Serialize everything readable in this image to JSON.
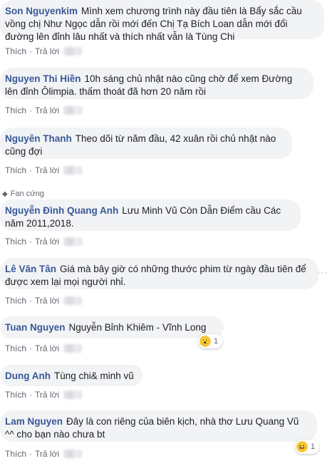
{
  "actions": {
    "like": "Thích",
    "reply": "Trả lời",
    "separator": "·"
  },
  "fan_badge": "Fan cứng",
  "comments": [
    {
      "name": "Son Nguyenkim",
      "text": "Mình xem chương trình này đầu tiên là Bẩy sắc cầu vồng chị Như Ngọc dẫn rồi mới đến Chị Tạ Bích Loan dẫn mới đổi đường lên đỉnh lâu nhất và thích nhất vẫn là Tùng Chi"
    },
    {
      "name": "Nguyen Thi Hiền",
      "text": "10h sáng chủ nhật nào cũng chờ để xem Đường lên đỉnh Ôlimpia. thấm thoát đã hơn 20 năm rồi"
    },
    {
      "name": "Nguyên Thanh",
      "text": "Theo dõi từ năm đầu, 42 xuân rồi chủ nhật nào cũng đợi"
    },
    {
      "name": "Nguyễn Đình Quang Anh",
      "text": "Lưu Minh Vũ Còn Dẫn Điểm cầu Các năm 2011,2018."
    },
    {
      "name": "Lê Văn Tân",
      "text": "Giá mà bây giờ có những thước phim từ ngày đầu tiên để được xem lại mọi người nhỉ."
    },
    {
      "name": "Tuan Nguyen",
      "text": "Nguyễn Bỉnh Khiêm - Vĩnh Long",
      "reaction_count": "1"
    },
    {
      "name": "Dung Anh",
      "text": "Tùng chi& minh vũ"
    },
    {
      "name": "Lam Nguyen",
      "text": "Đây là con riêng của biên kịch, nhà thơ Lưu Quang Vũ ^^ cho bạn nào chưa bt",
      "reaction_count": "1"
    }
  ]
}
